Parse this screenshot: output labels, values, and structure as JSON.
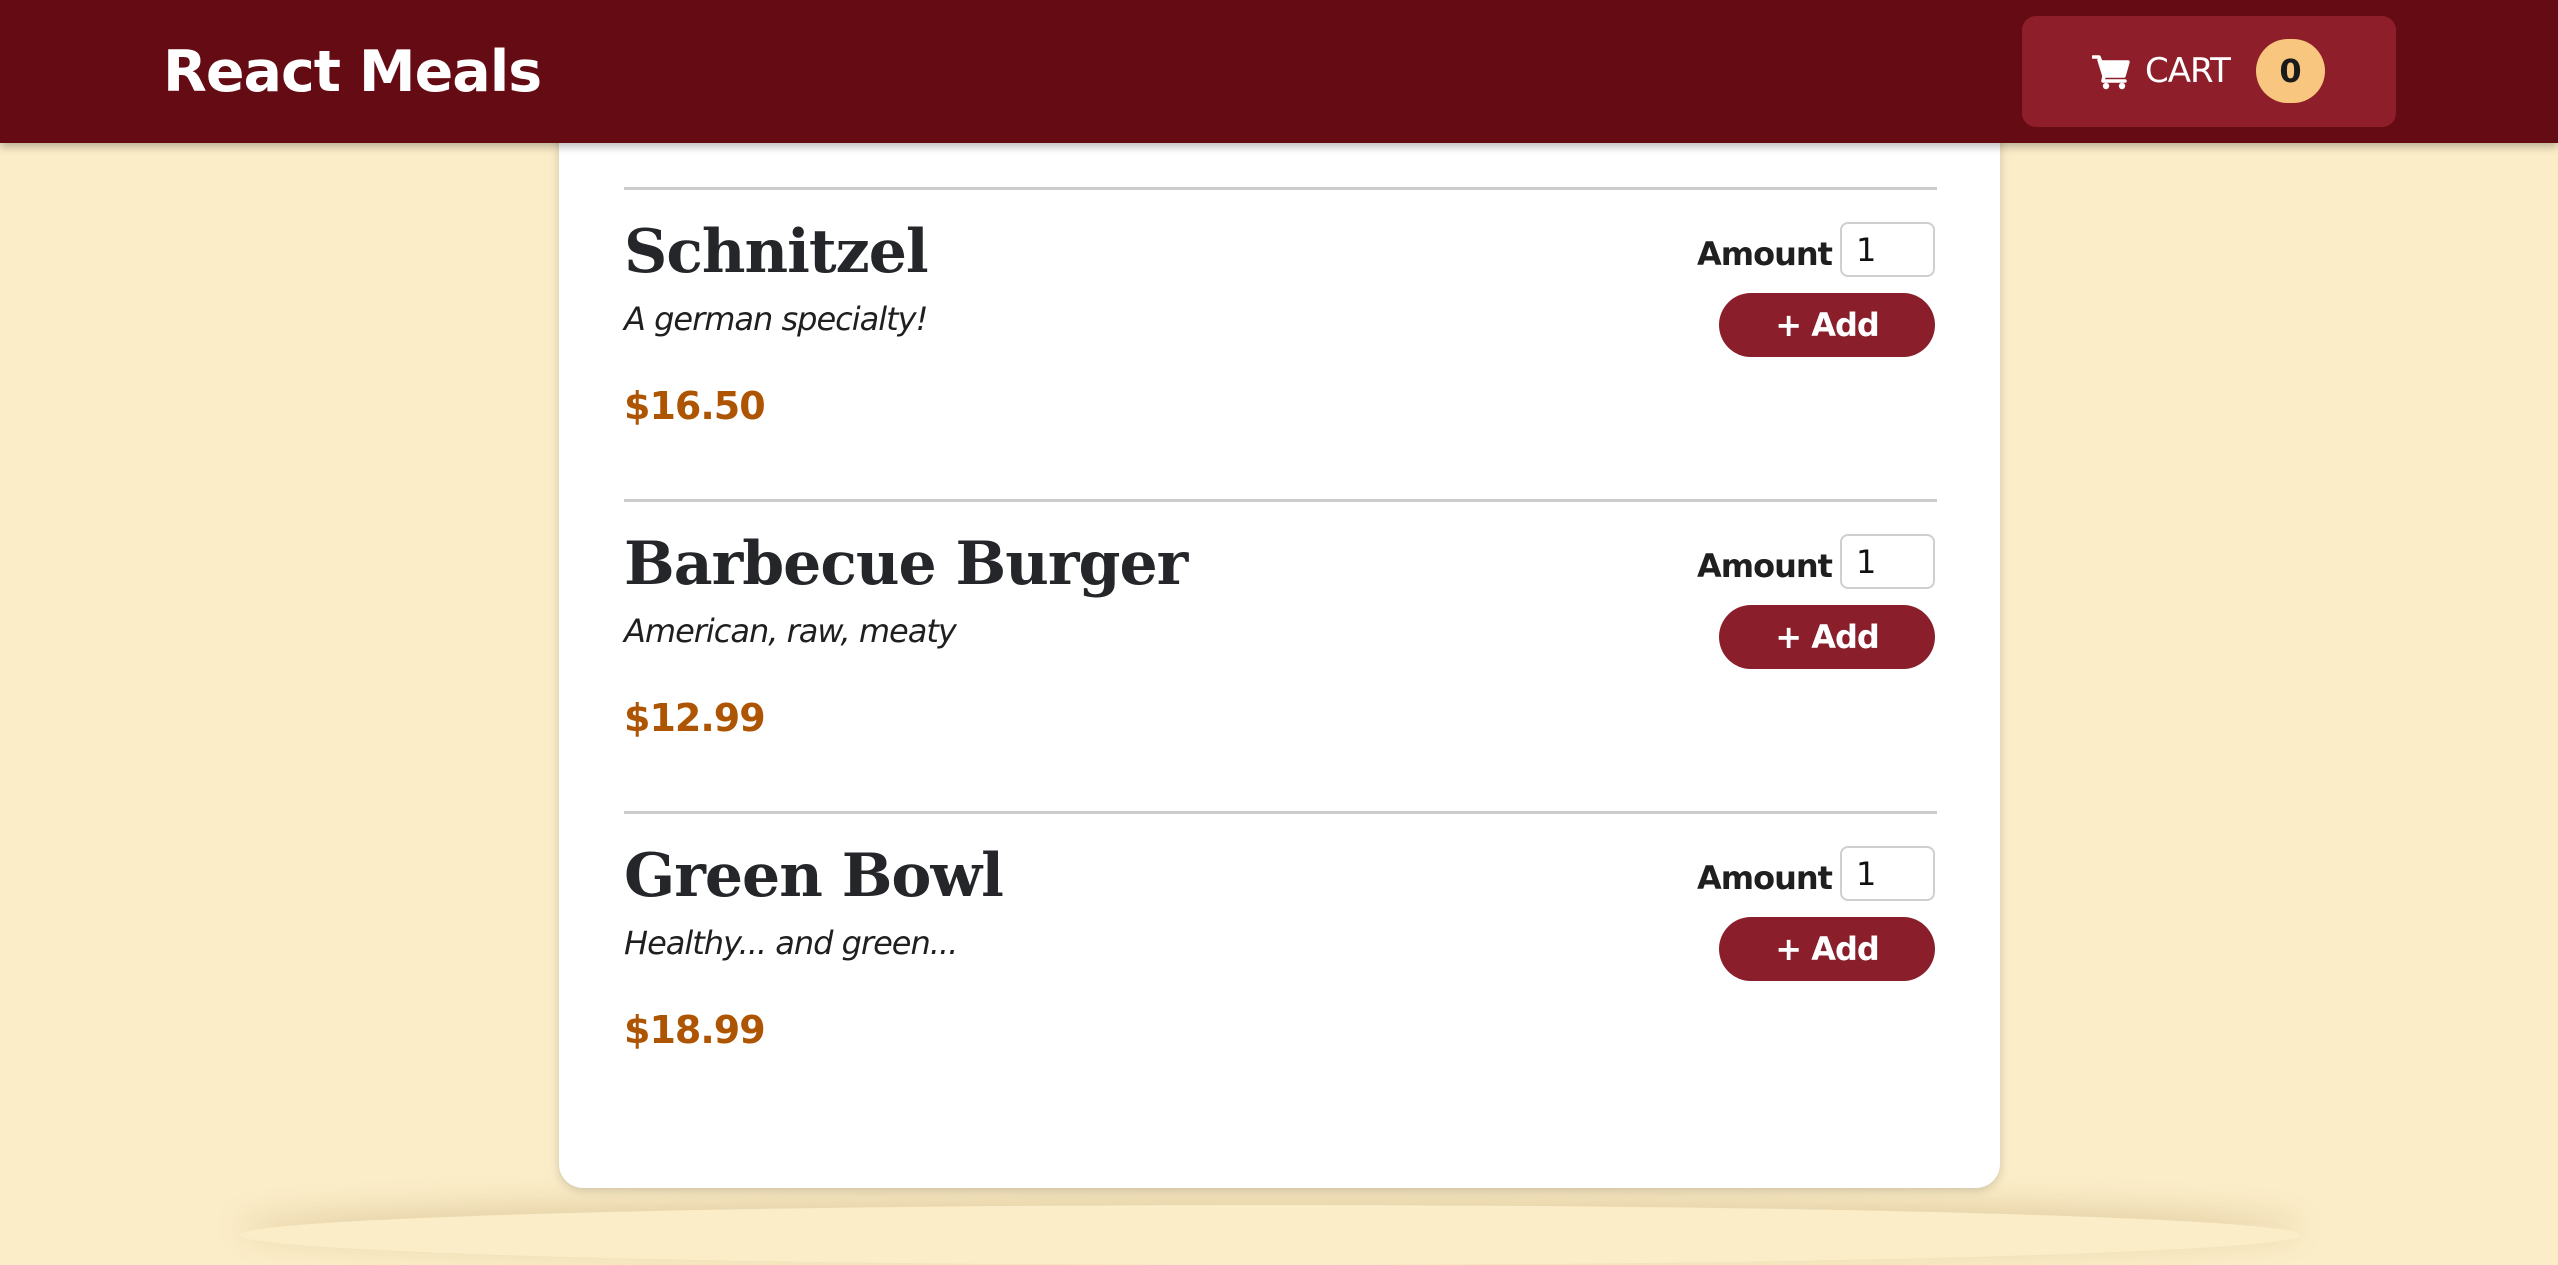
{
  "header": {
    "title": "React Meals",
    "cart": {
      "icon": "shopping-cart-icon",
      "label": "CART",
      "count": "0"
    }
  },
  "meals": [
    {
      "name": "Schnitzel",
      "description": "A german specialty!",
      "price": "$16.50",
      "amount_label": "Amount",
      "amount_value": "1",
      "add_label": "+ Add"
    },
    {
      "name": "Barbecue Burger",
      "description": "American, raw, meaty",
      "price": "$12.99",
      "amount_label": "Amount",
      "amount_value": "1",
      "add_label": "+ Add"
    },
    {
      "name": "Green Bowl",
      "description": "Healthy... and green...",
      "price": "$18.99",
      "amount_label": "Amount",
      "amount_value": "1",
      "add_label": "+ Add"
    }
  ],
  "colors": {
    "header_bg": "#650b14",
    "page_bg": "#fbedc8",
    "cart_button_bg": "#8e1f2a",
    "badge_bg": "#f8c67e",
    "price": "#ad5502",
    "add_button_bg": "#8a1e2a"
  }
}
